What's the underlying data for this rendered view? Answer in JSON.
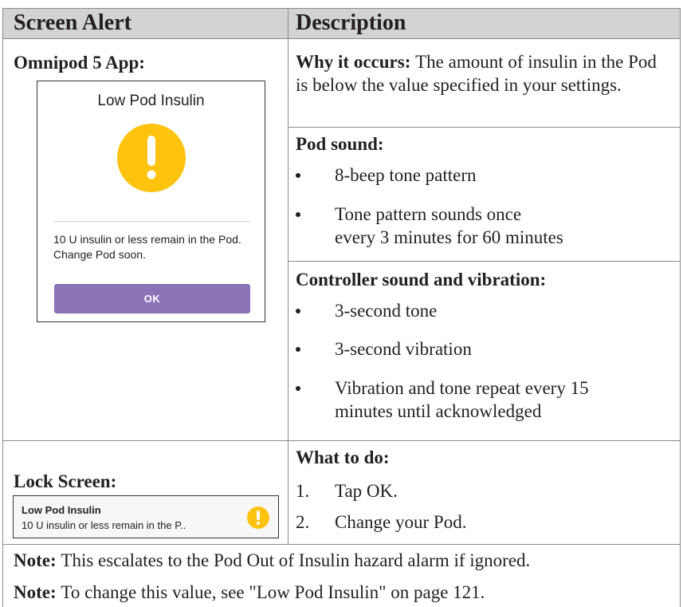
{
  "header": {
    "col1": "Screen Alert",
    "col2": "Description"
  },
  "left": {
    "app_label": "Omnipod 5 App:",
    "app_screen": {
      "title": "Low Pod Insulin",
      "message": "10 U insulin or less remain in the Pod. Change Pod soon.",
      "ok_button": "OK",
      "icon": "exclamation-warning-icon",
      "icon_color": "#fdc30f",
      "button_color": "#8b73b8"
    },
    "lock_label": "Lock Screen:",
    "lock_screen": {
      "title": "Low Pod Insulin",
      "message": "10 U insulin or less remain in the P..",
      "icon": "exclamation-warning-icon"
    }
  },
  "right": {
    "why": {
      "label": "Why it occurs:",
      "text": "The amount of insulin in the Pod is below the value specified in your settings."
    },
    "pod_sound": {
      "title": "Pod sound:",
      "items": [
        "8-beep tone pattern",
        "Tone pattern sounds once every 3 minutes for 60 minutes"
      ]
    },
    "controller": {
      "title": "Controller sound and vibration:",
      "items": [
        "3-second tone",
        "3-second vibration",
        "Vibration and tone repeat every 15 minutes until acknowledged"
      ]
    },
    "what_to_do": {
      "title": "What to do:",
      "steps": [
        {
          "num": "1.",
          "text": "Tap OK."
        },
        {
          "num": "2.",
          "text": "Change your Pod."
        }
      ]
    }
  },
  "notes": [
    {
      "label": "Note:",
      "text": "This escalates to the Pod Out of Insulin hazard alarm if ignored."
    },
    {
      "label": "Note:",
      "text": "To change this value, see \"Low Pod Insulin\" on page 121."
    }
  ]
}
